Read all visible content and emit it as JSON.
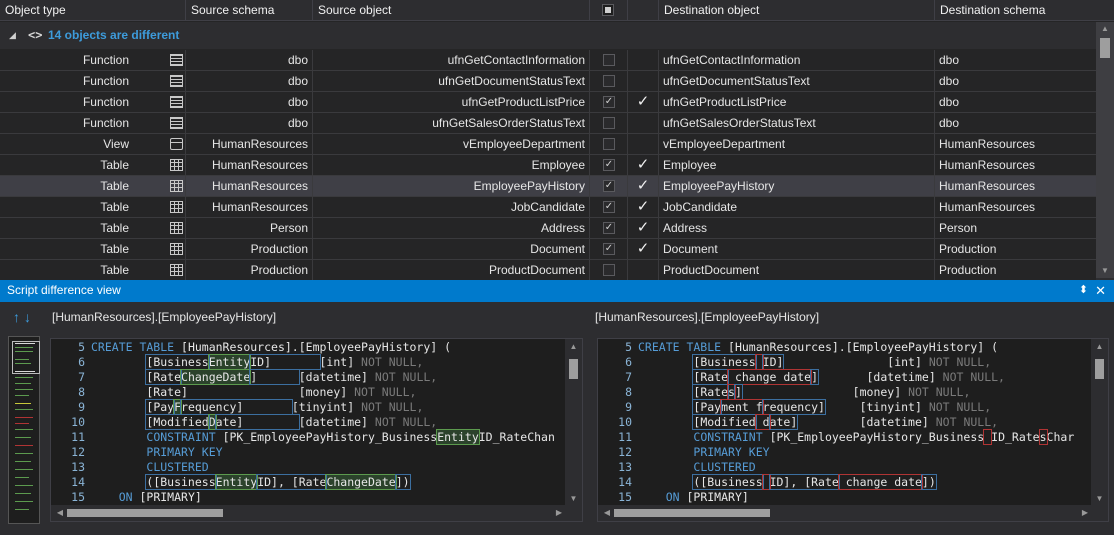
{
  "grid": {
    "columns": [
      "Object type",
      "Source schema",
      "Source object",
      "",
      "Destination object",
      "Destination schema"
    ],
    "group_expand_glyph": "◢",
    "group_icon_text": "<>",
    "group_title": "14 objects are different",
    "rows": [
      {
        "type": "Function",
        "icon": "function-icon",
        "sschema": "dbo",
        "sobj": "ufnGetContactInformation",
        "checked": false,
        "mark": "",
        "dobj": "ufnGetContactInformation",
        "dschema": "dbo"
      },
      {
        "type": "Function",
        "icon": "function-icon",
        "sschema": "dbo",
        "sobj": "ufnGetDocumentStatusText",
        "checked": false,
        "mark": "",
        "dobj": "ufnGetDocumentStatusText",
        "dschema": "dbo"
      },
      {
        "type": "Function",
        "icon": "function-icon",
        "sschema": "dbo",
        "sobj": "ufnGetProductListPrice",
        "checked": true,
        "mark": "✓",
        "dobj": "ufnGetProductListPrice",
        "dschema": "dbo"
      },
      {
        "type": "Function",
        "icon": "function-icon",
        "sschema": "dbo",
        "sobj": "ufnGetSalesOrderStatusText",
        "checked": false,
        "mark": "",
        "dobj": "ufnGetSalesOrderStatusText",
        "dschema": "dbo"
      },
      {
        "type": "View",
        "icon": "view-icon",
        "sschema": "HumanResources",
        "sobj": "vEmployeeDepartment",
        "checked": false,
        "mark": "",
        "dobj": "vEmployeeDepartment",
        "dschema": "HumanResources"
      },
      {
        "type": "Table",
        "icon": "table-icon",
        "sschema": "HumanResources",
        "sobj": "Employee",
        "checked": true,
        "mark": "✓",
        "dobj": "Employee",
        "dschema": "HumanResources"
      },
      {
        "type": "Table",
        "icon": "table-icon",
        "sschema": "HumanResources",
        "sobj": "EmployeePayHistory",
        "checked": true,
        "mark": "✓",
        "dobj": "EmployeePayHistory",
        "dschema": "HumanResources",
        "selected": true
      },
      {
        "type": "Table",
        "icon": "table-icon",
        "sschema": "HumanResources",
        "sobj": "JobCandidate",
        "checked": true,
        "mark": "✓",
        "dobj": "JobCandidate",
        "dschema": "HumanResources"
      },
      {
        "type": "Table",
        "icon": "table-icon",
        "sschema": "Person",
        "sobj": "Address",
        "checked": true,
        "mark": "✓",
        "dobj": "Address",
        "dschema": "Person"
      },
      {
        "type": "Table",
        "icon": "table-icon",
        "sschema": "Production",
        "sobj": "Document",
        "checked": true,
        "mark": "✓",
        "dobj": "Document",
        "dschema": "Production"
      },
      {
        "type": "Table",
        "icon": "table-icon",
        "sschema": "Production",
        "sobj": "ProductDocument",
        "checked": false,
        "mark": "",
        "dobj": "ProductDocument",
        "dschema": "Production"
      }
    ]
  },
  "panel": {
    "title": "Script difference view",
    "pin_glyph": "📌",
    "close_glyph": "✕",
    "nav_prev": "↑",
    "nav_next": "↓",
    "left_label": "[HumanResources].[EmployeePayHistory]",
    "right_label": "[HumanResources].[EmployeePayHistory]"
  },
  "left_code": [
    {
      "n": "5",
      "parts": [
        [
          "kw",
          "CREATE TABLE "
        ],
        [
          "id",
          "[HumanResources].[EmployeePayHistory] ("
        ]
      ]
    },
    {
      "n": "6",
      "parts": [
        [
          "id",
          "        "
        ],
        [
          "box",
          "[Business"
        ],
        [
          "ad",
          "Entity"
        ],
        [
          "box",
          "ID]       "
        ],
        [
          "ty",
          "[int] "
        ],
        [
          "nn",
          "NOT NULL,"
        ]
      ]
    },
    {
      "n": "7",
      "parts": [
        [
          "id",
          "        "
        ],
        [
          "box",
          "[Rate"
        ],
        [
          "ad",
          "ChangeDate"
        ],
        [
          "box",
          "]      "
        ],
        [
          "ty",
          "[datetime] "
        ],
        [
          "nn",
          "NOT NULL,"
        ]
      ]
    },
    {
      "n": "8",
      "parts": [
        [
          "id",
          "        [Rate]                [money] "
        ],
        [
          "nn",
          "NOT NULL,"
        ]
      ]
    },
    {
      "n": "9",
      "parts": [
        [
          "id",
          "        "
        ],
        [
          "box",
          "[Pay"
        ],
        [
          "ad",
          "F"
        ],
        [
          "box",
          "requency]       "
        ],
        [
          "ty",
          "[tinyint] "
        ],
        [
          "nn",
          "NOT NULL,"
        ]
      ]
    },
    {
      "n": "10",
      "parts": [
        [
          "id",
          "        "
        ],
        [
          "box",
          "[Modified"
        ],
        [
          "ad",
          "D"
        ],
        [
          "box",
          "ate]        "
        ],
        [
          "ty",
          "[datetime] "
        ],
        [
          "nn",
          "NOT NULL,"
        ]
      ]
    },
    {
      "n": "11",
      "parts": [
        [
          "id",
          "        "
        ],
        [
          "kw",
          "CONSTRAINT "
        ],
        [
          "id",
          "[PK_EmployeePayHistory_Business"
        ],
        [
          "ad",
          "Entity"
        ],
        [
          "id",
          "ID_RateChan"
        ]
      ]
    },
    {
      "n": "12",
      "parts": [
        [
          "id",
          "        "
        ],
        [
          "kw",
          "PRIMARY KEY"
        ]
      ]
    },
    {
      "n": "13",
      "parts": [
        [
          "id",
          "        "
        ],
        [
          "kw",
          "CLUSTERED"
        ]
      ]
    },
    {
      "n": "14",
      "parts": [
        [
          "id",
          "        "
        ],
        [
          "box",
          "([Business"
        ],
        [
          "ad",
          "Entity"
        ],
        [
          "box",
          "ID], [Rate"
        ],
        [
          "ad",
          "ChangeDate"
        ],
        [
          "box",
          "])"
        ]
      ]
    },
    {
      "n": "15",
      "parts": [
        [
          "id",
          "    "
        ],
        [
          "kw",
          "ON "
        ],
        [
          "id",
          "[PRIMARY]"
        ]
      ]
    }
  ],
  "right_code": [
    {
      "n": "5",
      "parts": [
        [
          "kw",
          "CREATE TABLE "
        ],
        [
          "id",
          "[HumanResources].[EmployeePayHistory] ("
        ]
      ]
    },
    {
      "n": "6",
      "parts": [
        [
          "id",
          "        "
        ],
        [
          "box",
          "[Business"
        ],
        [
          "rm",
          " "
        ],
        [
          "box",
          "ID]"
        ],
        [
          "id",
          "               [int] "
        ],
        [
          "nn",
          "NOT NULL,"
        ]
      ]
    },
    {
      "n": "7",
      "parts": [
        [
          "id",
          "        "
        ],
        [
          "box",
          "[Rate"
        ],
        [
          "rm",
          " change date"
        ],
        [
          "box",
          "]"
        ],
        [
          "id",
          "       [datetime] "
        ],
        [
          "nn",
          "NOT NULL,"
        ]
      ]
    },
    {
      "n": "8",
      "parts": [
        [
          "id",
          "        "
        ],
        [
          "box",
          "[Rate"
        ],
        [
          "rm",
          "s"
        ],
        [
          "box",
          "]"
        ],
        [
          "id",
          "                [money] "
        ],
        [
          "nn",
          "NOT NULL,"
        ]
      ]
    },
    {
      "n": "9",
      "parts": [
        [
          "id",
          "        "
        ],
        [
          "box",
          "[Pay"
        ],
        [
          "rm",
          "ment f"
        ],
        [
          "box",
          "requency]"
        ],
        [
          "id",
          "     [tinyint] "
        ],
        [
          "nn",
          "NOT NULL,"
        ]
      ]
    },
    {
      "n": "10",
      "parts": [
        [
          "id",
          "        "
        ],
        [
          "box",
          "[Modified"
        ],
        [
          "rm",
          " d"
        ],
        [
          "box",
          "ate]"
        ],
        [
          "id",
          "         [datetime] "
        ],
        [
          "nn",
          "NOT NULL,"
        ]
      ]
    },
    {
      "n": "11",
      "parts": [
        [
          "id",
          "        "
        ],
        [
          "kw",
          "CONSTRAINT "
        ],
        [
          "id",
          "[PK_EmployeePayHistory_Business"
        ],
        [
          "rm",
          " "
        ],
        [
          "id",
          "ID_Rate"
        ],
        [
          "rm",
          "s"
        ],
        [
          "id",
          "Char"
        ]
      ]
    },
    {
      "n": "12",
      "parts": [
        [
          "id",
          "        "
        ],
        [
          "kw",
          "PRIMARY KEY"
        ]
      ]
    },
    {
      "n": "13",
      "parts": [
        [
          "id",
          "        "
        ],
        [
          "kw",
          "CLUSTERED"
        ]
      ]
    },
    {
      "n": "14",
      "parts": [
        [
          "id",
          "        "
        ],
        [
          "box",
          "([Business"
        ],
        [
          "rm",
          " "
        ],
        [
          "box",
          "ID], [Rate"
        ],
        [
          "rm",
          " change date"
        ],
        [
          "box",
          "])"
        ]
      ]
    },
    {
      "n": "15",
      "parts": [
        [
          "id",
          "    "
        ],
        [
          "kw",
          "ON "
        ],
        [
          "id",
          "[PRIMARY]"
        ]
      ]
    }
  ],
  "colors": {
    "accent": "#007acc",
    "added": "#5c9a4e",
    "removed": "#b03434",
    "keyword": "#569cd6",
    "group_title": "#3d9bdb"
  },
  "scroll": {
    "left_up": "▲",
    "left_down": "▼",
    "left_hl": "◀",
    "left_hr": "▶",
    "right_up": "▲",
    "right_down": "▼",
    "right_hl": "◀",
    "right_hr": "▶",
    "grid_up": "▲",
    "grid_down": "▼"
  }
}
